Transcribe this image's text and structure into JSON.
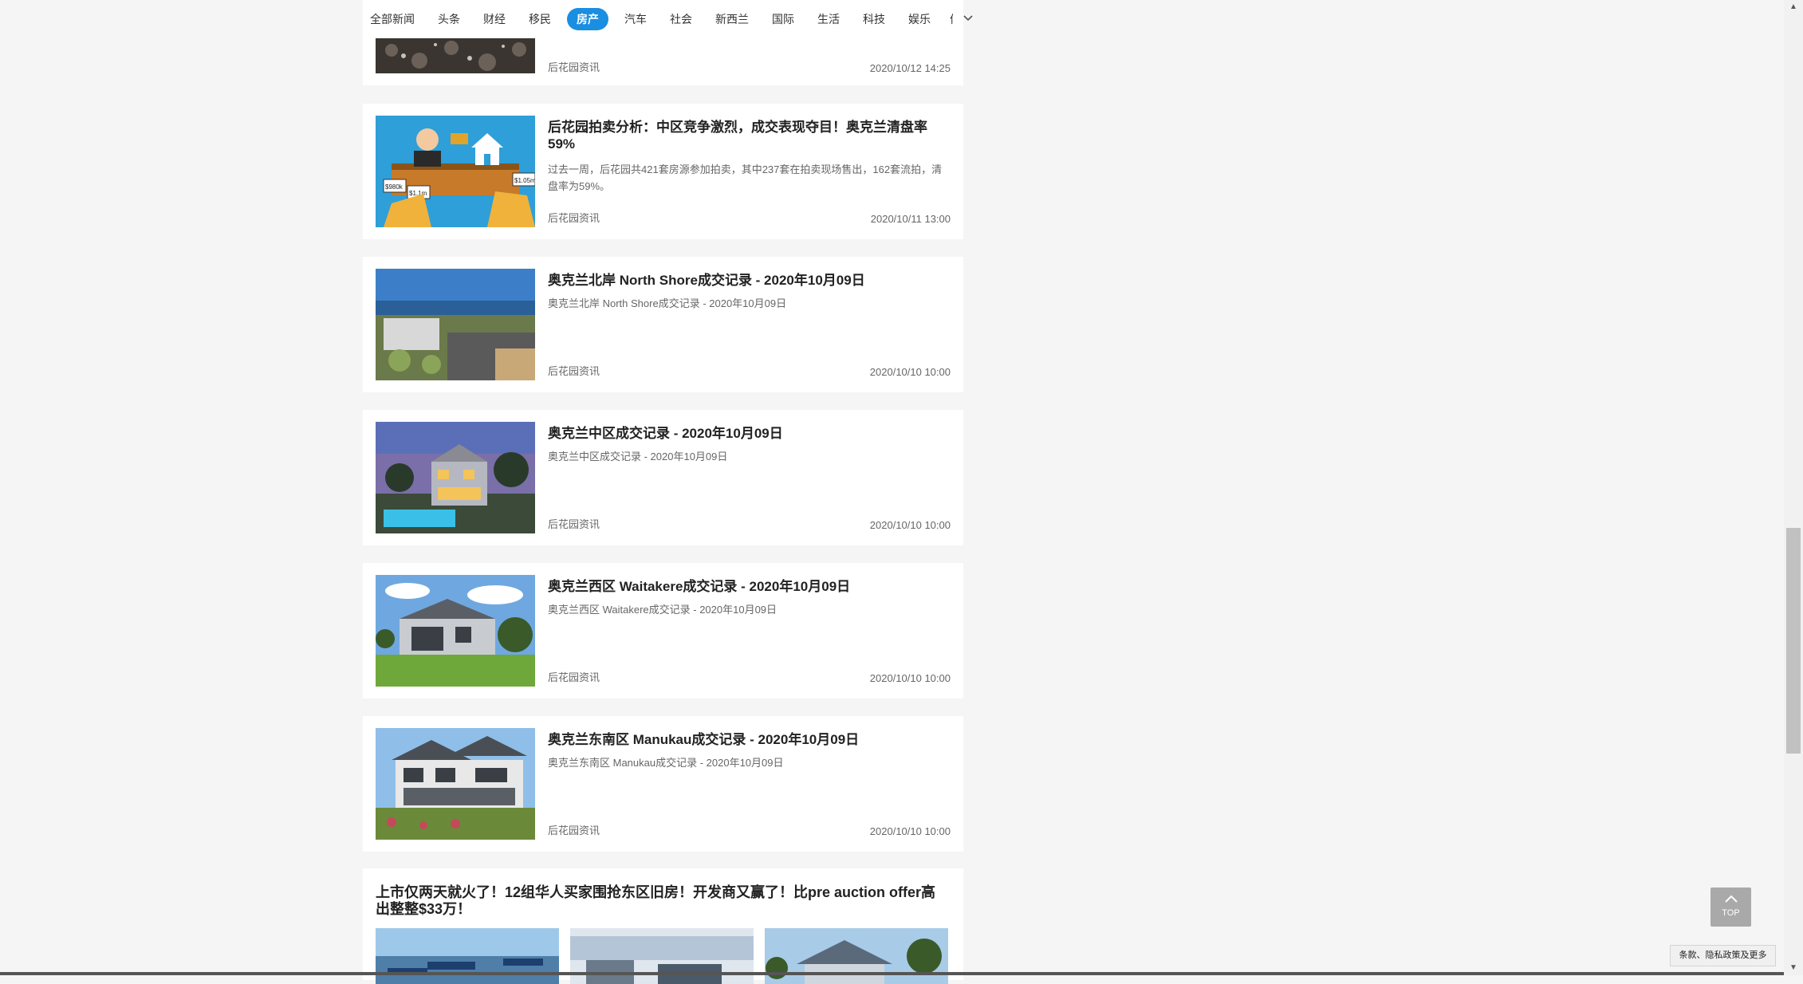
{
  "nav": {
    "tabs": [
      {
        "label": "全部新闻"
      },
      {
        "label": "头条"
      },
      {
        "label": "财经"
      },
      {
        "label": "移民"
      },
      {
        "label": "房产",
        "active": true
      },
      {
        "label": "汽车"
      },
      {
        "label": "社会"
      },
      {
        "label": "新西兰"
      },
      {
        "label": "国际"
      },
      {
        "label": "生活"
      },
      {
        "label": "科技"
      },
      {
        "label": "娱乐"
      }
    ],
    "cut_tab": "体",
    "more_icon": "chevron-down-icon",
    "accent_color": "#1a8ee1"
  },
  "articles": [
    {
      "title": "",
      "summary": "",
      "source": "后花园资讯",
      "time": "2020/10/12 14:25"
    },
    {
      "title": "后花园拍卖分析：中区竞争激烈，成交表现夺目！奥克兰清盘率59%",
      "summary": "过去一周，后花园共421套房源参加拍卖，其中237套在拍卖现场售出，162套流拍，清盘率为59%。",
      "source": "后花园资讯",
      "time": "2020/10/11 13:00",
      "thumb_labels": [
        "$980k",
        "$1.1m",
        "$1.05m"
      ]
    },
    {
      "title": "奥克兰北岸 North Shore成交记录 - 2020年10月09日",
      "summary": "奥克兰北岸 North Shore成交记录 - 2020年10月09日",
      "source": "后花园资讯",
      "time": "2020/10/10 10:00"
    },
    {
      "title": "奥克兰中区成交记录 - 2020年10月09日",
      "summary": "奥克兰中区成交记录 - 2020年10月09日",
      "source": "后花园资讯",
      "time": "2020/10/10 10:00"
    },
    {
      "title": "奥克兰西区 Waitakere成交记录 - 2020年10月09日",
      "summary": "奥克兰西区 Waitakere成交记录 - 2020年10月09日",
      "source": "后花园资讯",
      "time": "2020/10/10 10:00"
    },
    {
      "title": "奥克兰东南区 Manukau成交记录 - 2020年10月09日",
      "summary": "奥克兰东南区 Manukau成交记录 - 2020年10月09日",
      "source": "后花园资讯",
      "time": "2020/10/10 10:00"
    }
  ],
  "feature": {
    "title": "上市仅两天就火了！12组华人买家围抢东区旧房！开发商又赢了！比pre auction offer高出整整$33万！"
  },
  "back_to_top": {
    "label": "TOP",
    "icon": "arrow-up-icon"
  },
  "footnote": "条款、隐私政策及更多"
}
